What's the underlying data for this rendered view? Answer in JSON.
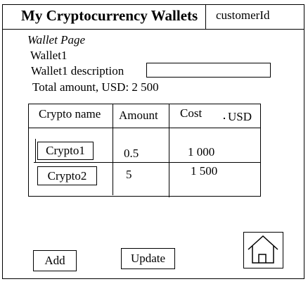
{
  "header": {
    "title": "My Cryptocurrency Wallets",
    "customer": "customerId"
  },
  "page": {
    "label": "Wallet Page"
  },
  "wallet": {
    "name": "Wallet1",
    "description_label": "Wallet1 description",
    "description_value": "",
    "total_label": "Total amount, USD:",
    "total_value": "2 500"
  },
  "table": {
    "headers": {
      "name": "Crypto name",
      "amount": "Amount",
      "cost": "Cost",
      "currency": "USD"
    },
    "rows": [
      {
        "name": "Crypto1",
        "amount": "0.5",
        "cost": "1 000"
      },
      {
        "name": "Crypto2",
        "amount": "5",
        "cost": "1 500"
      }
    ]
  },
  "buttons": {
    "add": "Add",
    "update": "Update"
  },
  "icons": {
    "home": "home-icon"
  }
}
